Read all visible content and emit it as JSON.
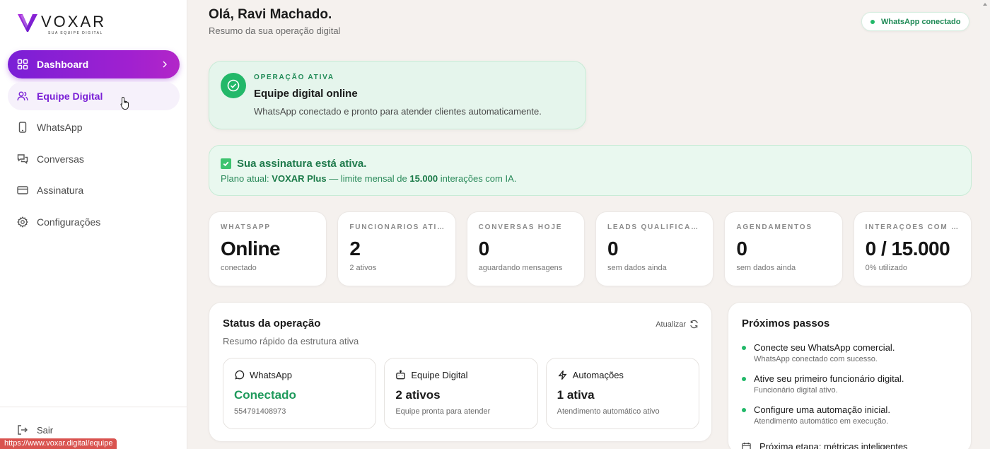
{
  "brand": {
    "name": "VOXAR",
    "tagline": "SUA EQUIPE DIGITAL",
    "accent": "#8a1fd6"
  },
  "sidebar": {
    "items": [
      {
        "label": "Dashboard",
        "icon": "grid-icon",
        "state": "active"
      },
      {
        "label": "Equipe Digital",
        "icon": "users-icon",
        "state": "hover"
      },
      {
        "label": "WhatsApp",
        "icon": "phone-icon",
        "state": "normal"
      },
      {
        "label": "Conversas",
        "icon": "chat-icon",
        "state": "normal"
      },
      {
        "label": "Assinatura",
        "icon": "card-icon",
        "state": "normal"
      },
      {
        "label": "Configurações",
        "icon": "gear-icon",
        "state": "normal"
      }
    ],
    "logout_label": "Sair"
  },
  "browser_status_url": "https://www.voxar.digital/equipe",
  "header": {
    "greeting": "Olá, Ravi Machado.",
    "subtitle": "Resumo da sua operação digital",
    "whatsapp_badge": "WhatsApp conectado"
  },
  "operation_banner": {
    "tag": "OPERAÇÃO ATIVA",
    "title": "Equipe digital online",
    "description": "WhatsApp conectado e pronto para atender clientes automaticamente."
  },
  "subscription_banner": {
    "title": "Sua assinatura está ativa.",
    "prefix": "Plano atual: ",
    "plan": "VOXAR Plus",
    "middle": " — limite mensal de ",
    "limit": "15.000",
    "suffix": " interações com IA."
  },
  "stats": [
    {
      "label": "WHATSAPP",
      "value": "Online",
      "note": "conectado"
    },
    {
      "label": "FUNCIONÁRIOS ATIVOS",
      "value": "2",
      "note": "2 ativos"
    },
    {
      "label": "CONVERSAS HOJE",
      "value": "0",
      "note": "aguardando mensagens"
    },
    {
      "label": "LEADS QUALIFICADOS",
      "value": "0",
      "note": "sem dados ainda"
    },
    {
      "label": "AGENDAMENTOS",
      "value": "0",
      "note": "sem dados ainda"
    },
    {
      "label": "INTERAÇÕES COM IA",
      "value": "0 / 15.000",
      "note": "0% utilizado"
    }
  ],
  "status_panel": {
    "title": "Status da operação",
    "subtitle": "Resumo rápido da estrutura ativa",
    "refresh_label": "Atualizar",
    "boxes": [
      {
        "label": "WhatsApp",
        "icon": "message-circle-icon",
        "value": "Conectado",
        "note": "554791408973",
        "value_color": "#1f9a5c"
      },
      {
        "label": "Equipe Digital",
        "icon": "bot-icon",
        "value": "2 ativos",
        "note": "Equipe pronta para atender"
      },
      {
        "label": "Automações",
        "icon": "bolt-icon",
        "value": "1 ativa",
        "note": "Atendimento automático ativo"
      }
    ]
  },
  "next_steps": {
    "title": "Próximos passos",
    "items": [
      {
        "main": "Conecte seu WhatsApp comercial.",
        "note": "WhatsApp conectado com sucesso."
      },
      {
        "main": "Ative seu primeiro funcionário digital.",
        "note": "Funcionário digital ativo."
      },
      {
        "main": "Configure uma automação inicial.",
        "note": "Atendimento automático em execução."
      }
    ],
    "upcoming": "Próxima etapa: métricas inteligentes"
  }
}
